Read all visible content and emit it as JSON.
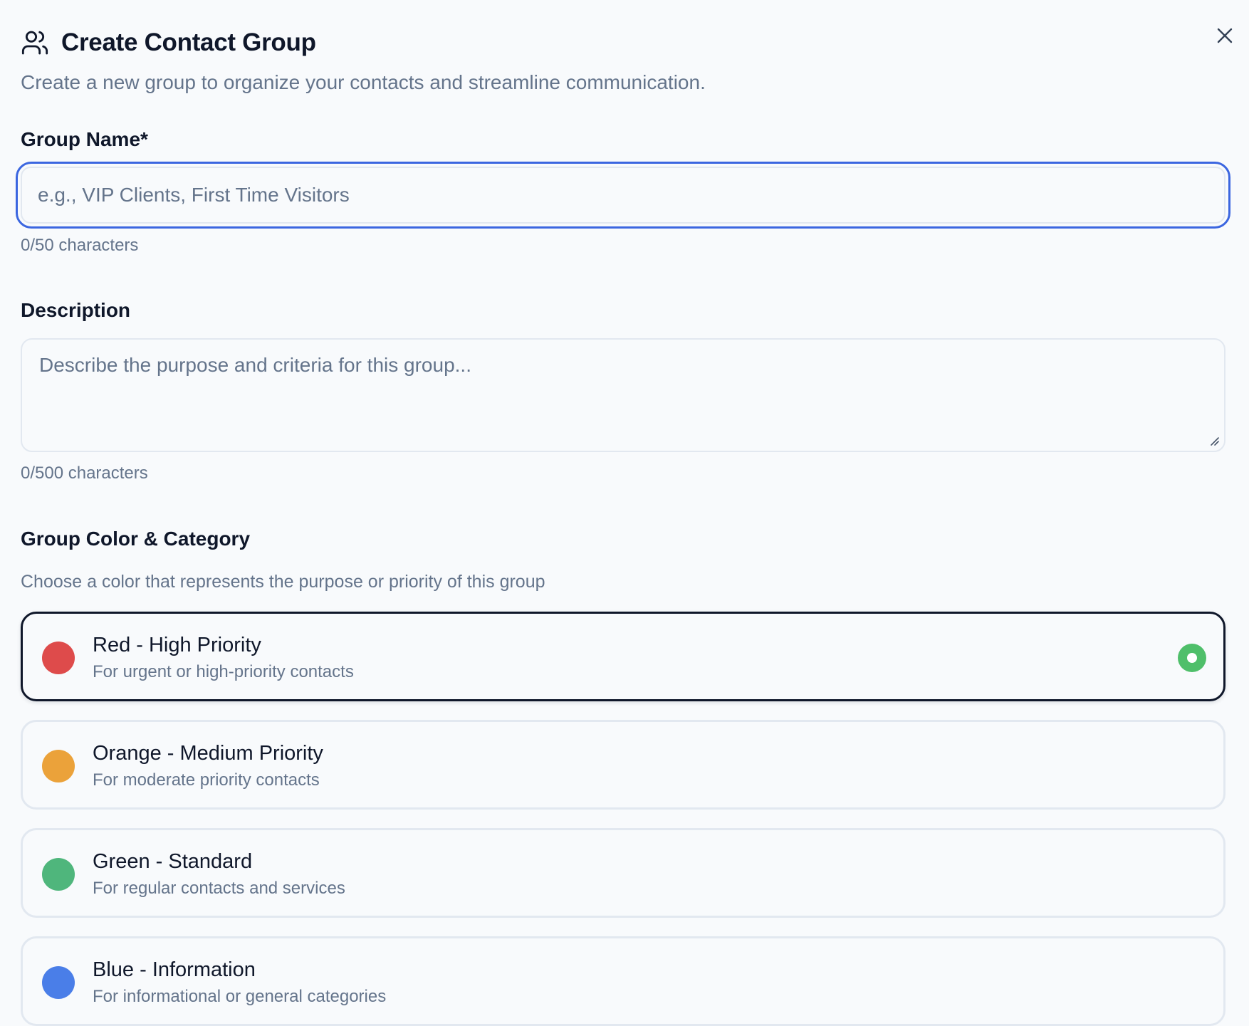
{
  "dialog": {
    "title": "Create Contact Group",
    "subtitle": "Create a new group to organize your contacts and streamline communication.",
    "title_icon": "users-icon",
    "close_icon": "close-icon"
  },
  "group_name": {
    "label": "Group Name*",
    "value": "",
    "placeholder": "e.g., VIP Clients, First Time Visitors",
    "counter": "0/50 characters"
  },
  "description": {
    "label": "Description",
    "value": "",
    "placeholder": "Describe the purpose and criteria for this group...",
    "counter": "0/500 characters"
  },
  "color_category": {
    "label": "Group Color & Category",
    "hint": "Choose a color that represents the purpose or priority of this group",
    "selected_index": 0,
    "selected_indicator_color": "#4fbf6a",
    "options": [
      {
        "title": "Red - High Priority",
        "description": "For urgent or high-priority contacts",
        "color": "#de4b4b"
      },
      {
        "title": "Orange - Medium Priority",
        "description": "For moderate priority contacts",
        "color": "#eba23a"
      },
      {
        "title": "Green - Standard",
        "description": "For regular contacts and services",
        "color": "#4fb67c"
      },
      {
        "title": "Blue - Information",
        "description": "For informational or general categories",
        "color": "#4a7ee8"
      }
    ]
  }
}
